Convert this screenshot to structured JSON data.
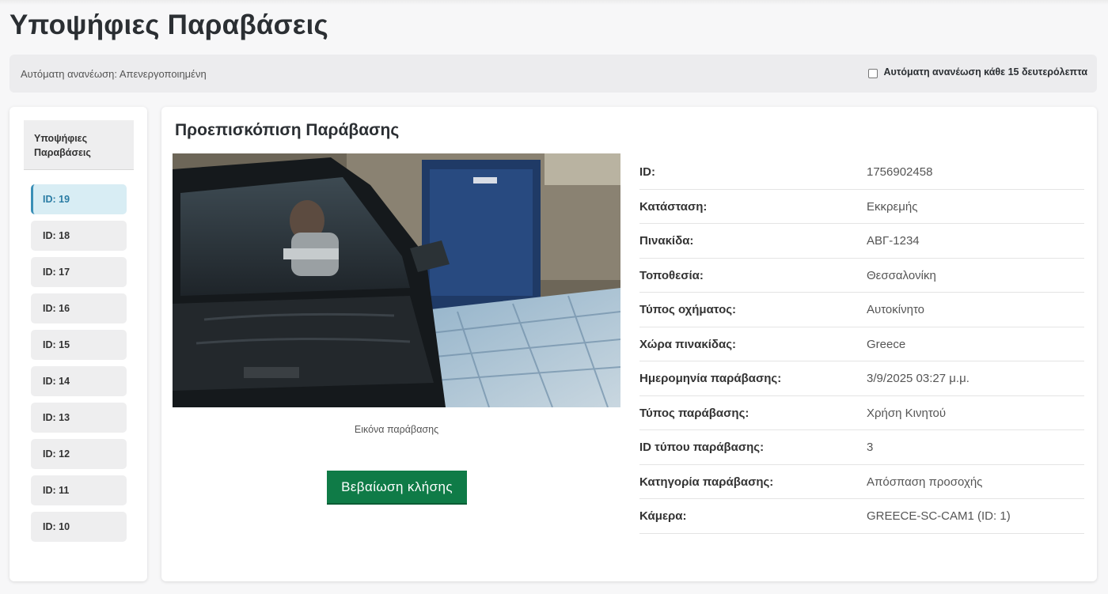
{
  "page": {
    "title": "Υποψήφιες Παραβάσεις"
  },
  "refresh": {
    "status": "Αυτόματη ανανέωση: Απενεργοποιημένη",
    "toggle_label": "Αυτόματη ανανέωση κάθε 15 δευτερόλεπτα",
    "checked": false
  },
  "sidebar": {
    "header": "Υποψήφιες Παραβάσεις",
    "items": [
      {
        "label": "ID: 19",
        "active": true
      },
      {
        "label": "ID: 18"
      },
      {
        "label": "ID: 17"
      },
      {
        "label": "ID: 16"
      },
      {
        "label": "ID: 15"
      },
      {
        "label": "ID: 14"
      },
      {
        "label": "ID: 13"
      },
      {
        "label": "ID: 12"
      },
      {
        "label": "ID: 11"
      },
      {
        "label": "ID: 10"
      }
    ]
  },
  "preview": {
    "title": "Προεπισκόπιση Παράβασης",
    "image_caption": "Εικόνα παράβασης",
    "confirm_button": "Βεβαίωση κλήσης",
    "details": [
      {
        "label": "ID:",
        "value": "1756902458"
      },
      {
        "label": "Κατάσταση:",
        "value": "Εκκρεμής"
      },
      {
        "label": "Πινακίδα:",
        "value": "ΑΒΓ-1234"
      },
      {
        "label": "Τοποθεσία:",
        "value": "Θεσσαλονίκη"
      },
      {
        "label": "Τύπος οχήματος:",
        "value": "Αυτοκίνητο"
      },
      {
        "label": "Χώρα πινακίδας:",
        "value": "Greece"
      },
      {
        "label": "Ημερομηνία παράβασης:",
        "value": "3/9/2025 03:27 μ.μ."
      },
      {
        "label": "Τύπος παράβασης:",
        "value": "Χρήση Κινητού"
      },
      {
        "label": "ID τύπου παράβασης:",
        "value": "3"
      },
      {
        "label": "Κατηγορία παράβασης:",
        "value": "Απόσπαση προσοχής"
      },
      {
        "label": "Κάμερα:",
        "value": "GREECE-SC-CAM1 (ID: 1)"
      }
    ]
  },
  "colors": {
    "accent_green": "#0f7b47",
    "active_blue": "#3a8fb7",
    "active_bg": "#d8edf4"
  }
}
